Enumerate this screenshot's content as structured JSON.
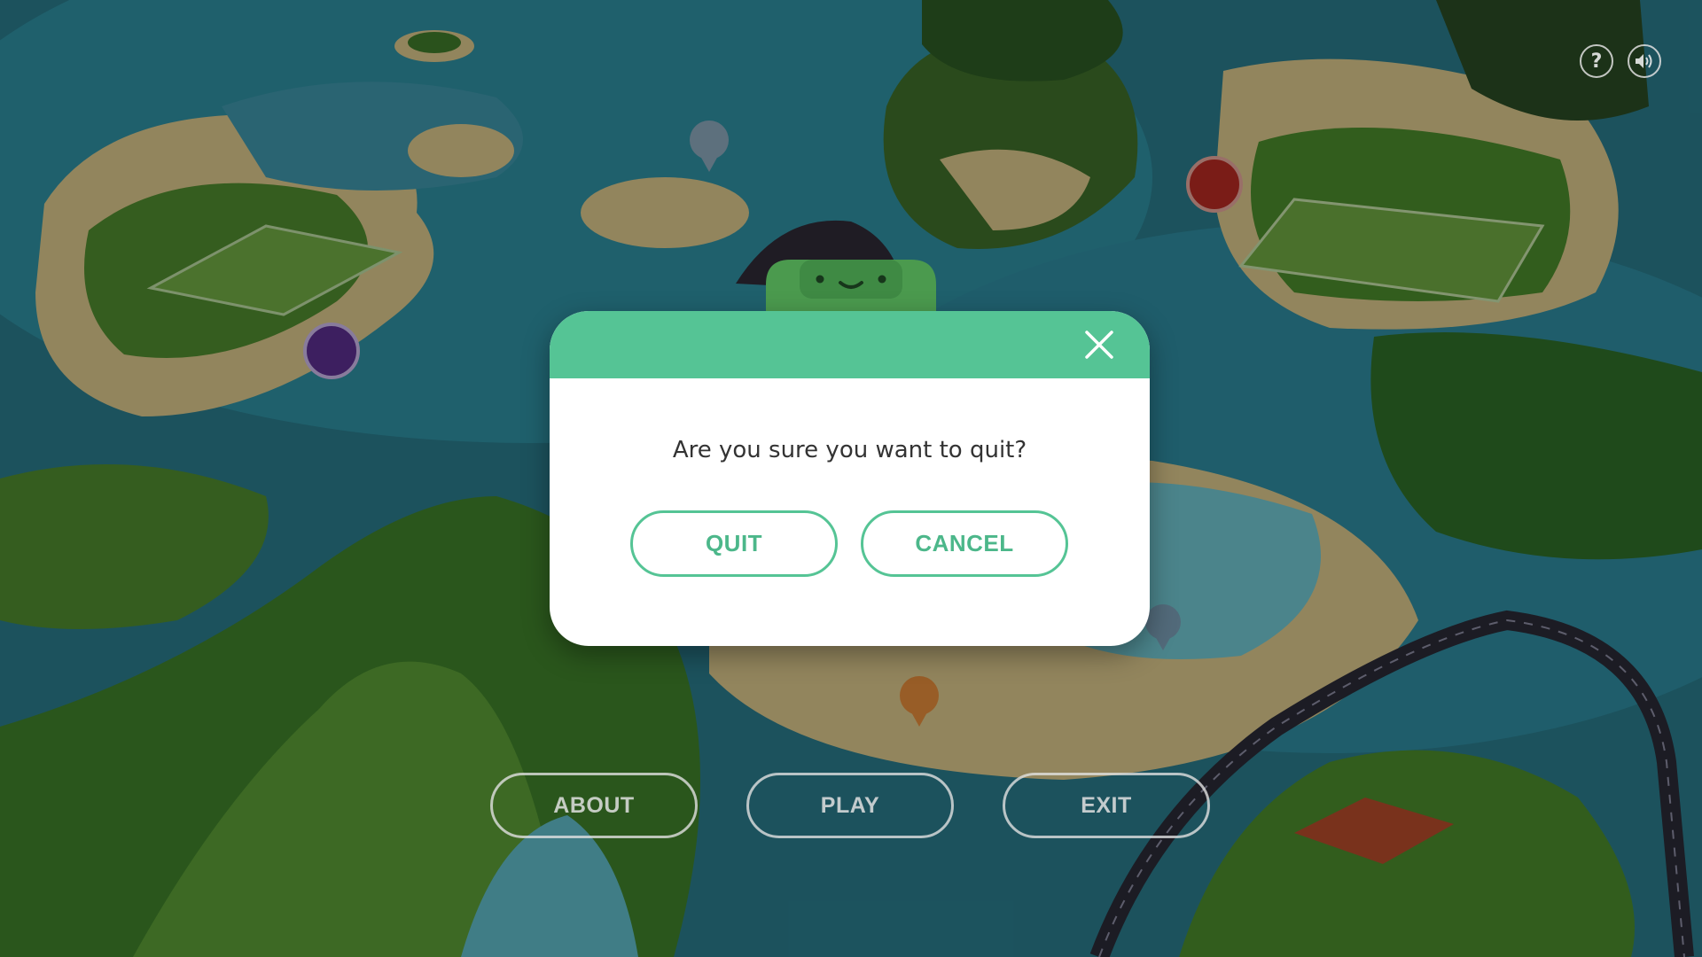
{
  "colors": {
    "accent": "#55c495",
    "accent_text": "#4cb78a",
    "dialog_bg": "#ffffff",
    "message_text": "#333333"
  },
  "top_bar": {
    "help_icon": "question-mark-icon",
    "help_glyph": "?",
    "sound_icon": "speaker-icon"
  },
  "dialog": {
    "message": "Are you sure you want to quit?",
    "quit_label": "QUIT",
    "cancel_label": "CANCEL",
    "close_icon": "close-icon"
  },
  "main_menu": {
    "about_label": "ABOUT",
    "play_label": "PLAY",
    "exit_label": "EXIT"
  },
  "map": {
    "markers": [
      "camera-pin-icon",
      "purple-pin-icon",
      "red-pin-icon",
      "orange-pin-icon",
      "blue-pin-icon"
    ]
  }
}
